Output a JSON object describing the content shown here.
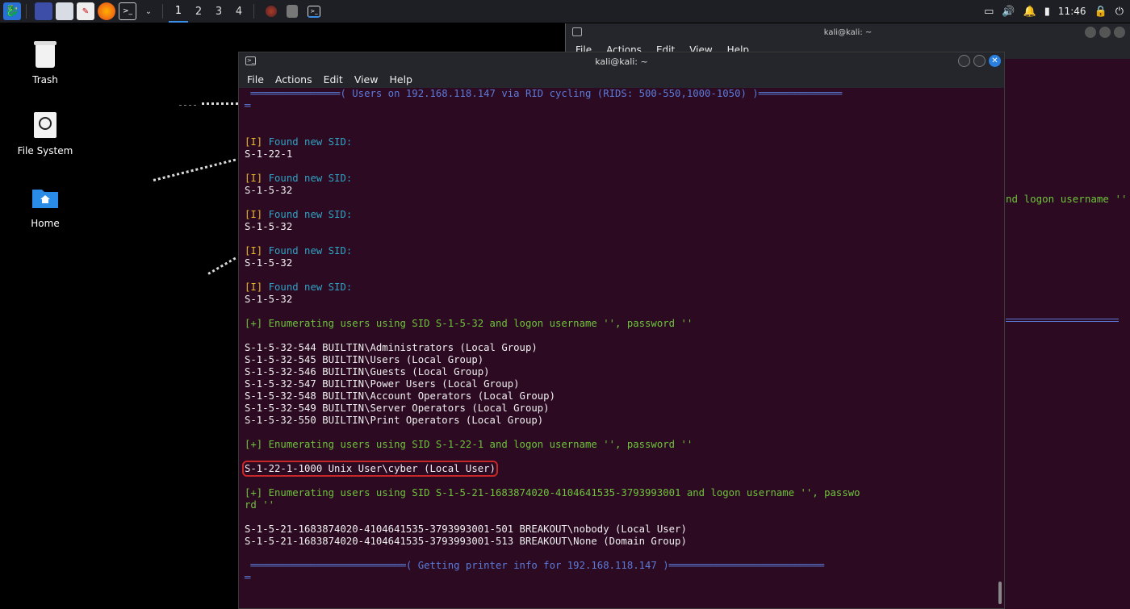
{
  "panel": {
    "workspaces": [
      "1",
      "2",
      "3",
      "4"
    ],
    "active_workspace": "1",
    "clock": "11:46",
    "icons": [
      "kali-menu-icon",
      "desktop-icon",
      "files-icon",
      "text-editor-icon",
      "firefox-icon",
      "terminal-icon",
      "chevron-down-icon"
    ]
  },
  "desktop": {
    "icons": [
      {
        "label": "Trash"
      },
      {
        "label": "File System"
      },
      {
        "label": "Home"
      }
    ]
  },
  "back_terminal": {
    "title": "kali@kali: ~",
    "menu": [
      "File",
      "Actions",
      "Edit",
      "View",
      "Help"
    ],
    "visible_text": "nd logon username ''"
  },
  "terminal": {
    "title": "kali@kali: ~",
    "menu": [
      "File",
      "Actions",
      "Edit",
      "View",
      "Help"
    ],
    "lines": [
      {
        "parts": [
          {
            "t": " ═══════════════( Users on 192.168.118.147 via RID cycling (RIDS: 500-550,1000-1050) )══════════════",
            "c": "blue"
          }
        ]
      },
      {
        "parts": [
          {
            "t": "═",
            "c": "blue"
          }
        ]
      },
      {
        "parts": []
      },
      {
        "parts": []
      },
      {
        "parts": [
          {
            "t": "[I]",
            "c": "yellow"
          },
          {
            "t": " Found new SID:",
            "c": "cyan"
          }
        ]
      },
      {
        "parts": [
          {
            "t": "S-1-22-1",
            "c": "white"
          }
        ]
      },
      {
        "parts": []
      },
      {
        "parts": [
          {
            "t": "[I]",
            "c": "yellow"
          },
          {
            "t": " Found new SID:",
            "c": "cyan"
          }
        ]
      },
      {
        "parts": [
          {
            "t": "S-1-5-32",
            "c": "white"
          }
        ]
      },
      {
        "parts": []
      },
      {
        "parts": [
          {
            "t": "[I]",
            "c": "yellow"
          },
          {
            "t": " Found new SID:",
            "c": "cyan"
          }
        ]
      },
      {
        "parts": [
          {
            "t": "S-1-5-32",
            "c": "white"
          }
        ]
      },
      {
        "parts": []
      },
      {
        "parts": [
          {
            "t": "[I]",
            "c": "yellow"
          },
          {
            "t": " Found new SID:",
            "c": "cyan"
          }
        ]
      },
      {
        "parts": [
          {
            "t": "S-1-5-32",
            "c": "white"
          }
        ]
      },
      {
        "parts": []
      },
      {
        "parts": [
          {
            "t": "[I]",
            "c": "yellow"
          },
          {
            "t": " Found new SID:",
            "c": "cyan"
          }
        ]
      },
      {
        "parts": [
          {
            "t": "S-1-5-32",
            "c": "white"
          }
        ]
      },
      {
        "parts": []
      },
      {
        "parts": [
          {
            "t": "[+] Enumerating users using SID S-1-5-32 and logon username '', password ''",
            "c": "green"
          }
        ]
      },
      {
        "parts": []
      },
      {
        "parts": [
          {
            "t": "S-1-5-32-544 BUILTIN\\Administrators (Local Group)",
            "c": "white"
          }
        ]
      },
      {
        "parts": [
          {
            "t": "S-1-5-32-545 BUILTIN\\Users (Local Group)",
            "c": "white"
          }
        ]
      },
      {
        "parts": [
          {
            "t": "S-1-5-32-546 BUILTIN\\Guests (Local Group)",
            "c": "white"
          }
        ]
      },
      {
        "parts": [
          {
            "t": "S-1-5-32-547 BUILTIN\\Power Users (Local Group)",
            "c": "white"
          }
        ]
      },
      {
        "parts": [
          {
            "t": "S-1-5-32-548 BUILTIN\\Account Operators (Local Group)",
            "c": "white"
          }
        ]
      },
      {
        "parts": [
          {
            "t": "S-1-5-32-549 BUILTIN\\Server Operators (Local Group)",
            "c": "white"
          }
        ]
      },
      {
        "parts": [
          {
            "t": "S-1-5-32-550 BUILTIN\\Print Operators (Local Group)",
            "c": "white"
          }
        ]
      },
      {
        "parts": []
      },
      {
        "parts": [
          {
            "t": "[+] Enumerating users using SID S-1-22-1 and logon username '', password ''",
            "c": "green"
          }
        ]
      },
      {
        "parts": []
      },
      {
        "parts": [
          {
            "t": "S-1-22-1-1000 Unix User\\cyber (Local User)",
            "c": "white",
            "highlight": true
          }
        ]
      },
      {
        "parts": []
      },
      {
        "parts": [
          {
            "t": "[+] Enumerating users using SID S-1-5-21-1683874020-4104641535-3793993001 and logon username '', passwo",
            "c": "green"
          }
        ]
      },
      {
        "parts": [
          {
            "t": "rd ''",
            "c": "green"
          }
        ]
      },
      {
        "parts": []
      },
      {
        "parts": [
          {
            "t": "S-1-5-21-1683874020-4104641535-3793993001-501 BREAKOUT\\nobody (Local User)",
            "c": "white"
          }
        ]
      },
      {
        "parts": [
          {
            "t": "S-1-5-21-1683874020-4104641535-3793993001-513 BREAKOUT\\None (Domain Group)",
            "c": "white"
          }
        ]
      },
      {
        "parts": []
      },
      {
        "parts": [
          {
            "t": " ══════════════════════════( Getting printer info for 192.168.118.147 )══════════════════════════",
            "c": "blue"
          }
        ]
      },
      {
        "parts": [
          {
            "t": "═",
            "c": "blue"
          }
        ]
      }
    ]
  }
}
